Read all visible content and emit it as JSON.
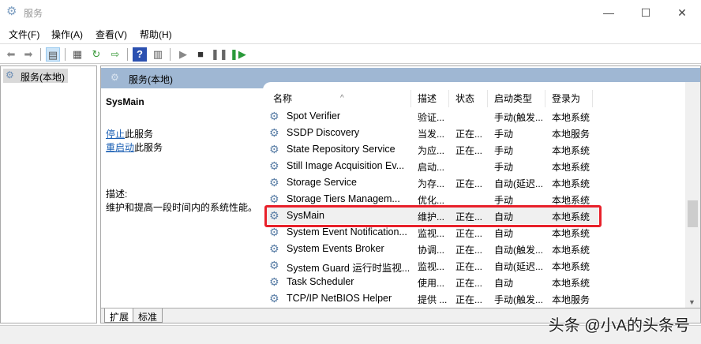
{
  "window": {
    "title": "服务",
    "minimize": "—",
    "maximize": "☐",
    "close": "✕"
  },
  "menu": [
    "文件(F)",
    "操作(A)",
    "查看(V)",
    "帮助(H)"
  ],
  "tree": {
    "selected": "服务(本地)"
  },
  "panel": {
    "header": "服务(本地)"
  },
  "detail": {
    "service_name": "SysMain",
    "stop_link": "停止",
    "stop_suffix": "此服务",
    "restart_link": "重启动",
    "restart_suffix": "此服务",
    "desc_label": "描述:",
    "description": "维护和提高一段时间内的系统性能。"
  },
  "columns": [
    "名称",
    "描述",
    "状态",
    "启动类型",
    "登录为"
  ],
  "services": [
    {
      "name": "Spot Verifier",
      "desc": "验证...",
      "status": "",
      "startup": "手动(触发...",
      "logon": "本地系统"
    },
    {
      "name": "SSDP Discovery",
      "desc": "当发...",
      "status": "正在...",
      "startup": "手动",
      "logon": "本地服务"
    },
    {
      "name": "State Repository Service",
      "desc": "为应...",
      "status": "正在...",
      "startup": "手动",
      "logon": "本地系统"
    },
    {
      "name": "Still Image Acquisition Ev...",
      "desc": "启动...",
      "status": "",
      "startup": "手动",
      "logon": "本地系统"
    },
    {
      "name": "Storage Service",
      "desc": "为存...",
      "status": "正在...",
      "startup": "自动(延迟...",
      "logon": "本地系统"
    },
    {
      "name": "Storage Tiers Managem...",
      "desc": "优化...",
      "status": "",
      "startup": "手动",
      "logon": "本地系统"
    },
    {
      "name": "SysMain",
      "desc": "维护...",
      "status": "正在...",
      "startup": "自动",
      "logon": "本地系统"
    },
    {
      "name": "System Event Notification...",
      "desc": "监视...",
      "status": "正在...",
      "startup": "自动",
      "logon": "本地系统"
    },
    {
      "name": "System Events Broker",
      "desc": "协调...",
      "status": "正在...",
      "startup": "自动(触发...",
      "logon": "本地系统"
    },
    {
      "name": "System Guard 运行时监视...",
      "desc": "监视...",
      "status": "正在...",
      "startup": "自动(延迟...",
      "logon": "本地系统"
    },
    {
      "name": "Task Scheduler",
      "desc": "使用...",
      "status": "正在...",
      "startup": "自动",
      "logon": "本地系统"
    },
    {
      "name": "TCP/IP NetBIOS Helper",
      "desc": "提供 ...",
      "status": "正在...",
      "startup": "手动(触发...",
      "logon": "本地服务"
    }
  ],
  "tabs": [
    "扩展",
    "标准"
  ],
  "watermark": "头条 @小A的头条号",
  "colors": {
    "highlight_box": "#e8202a",
    "panel_header": "#9fb7d3",
    "link": "#1a5fb4"
  }
}
